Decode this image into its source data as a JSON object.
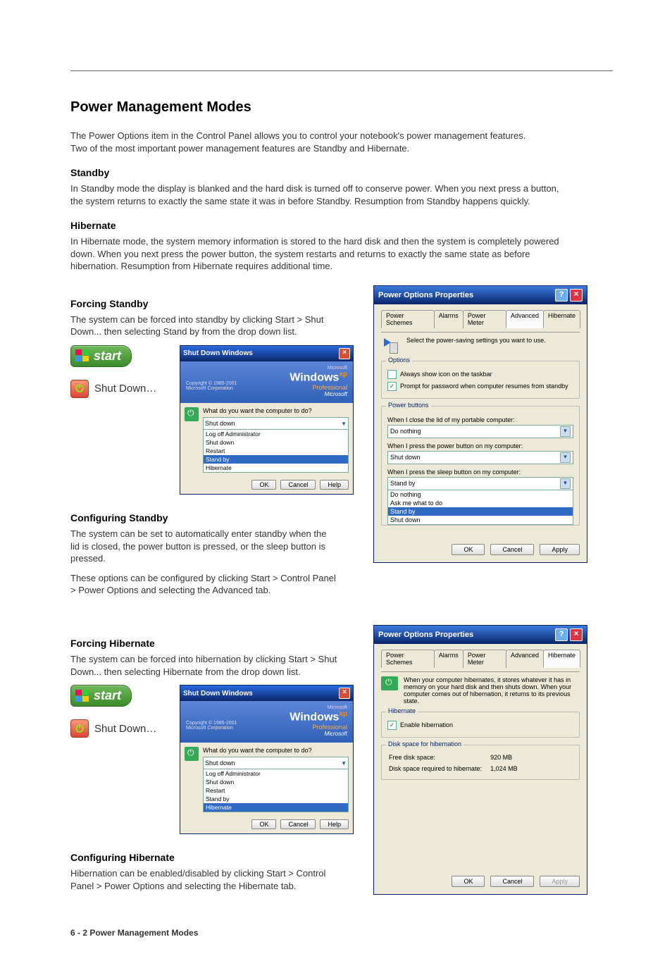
{
  "page": {
    "title": "Power Management Modes",
    "intro": "The Power Options item in the Control Panel allows you to control your notebook's power management features. Two of the most important power management features are Standby and Hibernate.",
    "standby_title": "Standby",
    "standby_body": "In Standby mode the display is blanked and the hard disk is turned off to conserve power. When you next press a button, the system returns to exactly the same state it was in before Standby. Resumption from Standby happens quickly.",
    "hibernate_title": "Hibernate",
    "hibernate_body": "In Hibernate mode, the system memory information is stored to the hard disk and then the system is completely powered down. When you next press the power button, the system restarts and returns to exactly the same state as before hibernation. Resumption from Hibernate requires additional time.",
    "standby_force_title": "Forcing Standby",
    "standby_force_body": "The system can be forced into standby by clicking Start > Shut Down... then selecting Stand by from the drop down list.",
    "standby_config_title": "Configuring Standby",
    "standby_config_body1": "The system can be set to automatically enter standby when the lid is closed, the power button is pressed, or the sleep button is pressed.",
    "standby_config_body2": "These options can be configured by clicking Start > Control Panel > Power Options and selecting the Advanced tab.",
    "hib_force_title": "Forcing Hibernate",
    "hib_force_body": "The system can be forced into hibernation by clicking Start > Shut Down... then selecting Hibernate from the drop down list.",
    "hib_config_title": "Configuring Hibernate",
    "hib_config_body": "Hibernation can be enabled/disabled by clicking Start > Control Panel > Power Options and selecting the Hibernate tab.",
    "pagenum": "6 - 2  Power Management Modes"
  },
  "start_label": "start",
  "shutdown_label": "Shut Down…",
  "shutdown_dialog": {
    "title": "Shut Down Windows",
    "brand1": "Microsoft",
    "brand2": "Windows",
    "brand3": "xp",
    "edition": "Professional",
    "copyright": "Copyright © 1985-2001",
    "corp": "Microsoft Corporation",
    "msft": "Microsoft",
    "question": "What do you want the computer to do?",
    "selected": "Shut down",
    "options": [
      "Log off Administrator",
      "Shut down",
      "Restart",
      "Stand by",
      "Hibernate"
    ],
    "ok": "OK",
    "cancel": "Cancel",
    "help": "Help"
  },
  "po_adv": {
    "title": "Power Options Properties",
    "tabs": [
      "Power Schemes",
      "Alarms",
      "Power Meter",
      "Advanced",
      "Hibernate"
    ],
    "desc": "Select the power-saving settings you want to use.",
    "grp_options": "Options",
    "chk1": "Always show icon on the taskbar",
    "chk2": "Prompt for password when computer resumes from standby",
    "grp_pb": "Power buttons",
    "lbl_lid": "When I close the lid of my portable computer:",
    "val_lid": "Do nothing",
    "lbl_pwr": "When I press the power button on my computer:",
    "val_pwr": "Shut down",
    "lbl_sleep": "When I press the sleep button on my computer:",
    "val_sleep": "Stand by",
    "dd_list": [
      "Do nothing",
      "Ask me what to do",
      "Stand by",
      "Shut down"
    ],
    "ok": "OK",
    "cancel": "Cancel",
    "apply": "Apply"
  },
  "po_hib": {
    "title": "Power Options Properties",
    "tabs": [
      "Power Schemes",
      "Alarms",
      "Power Meter",
      "Advanced",
      "Hibernate"
    ],
    "desc": "When your computer hibernates, it stores whatever it has in memory on your hard disk and then shuts down. When your computer comes out of hibernation, it returns to its previous state.",
    "grp_hib": "Hibernate",
    "chk": "Enable hibernation",
    "grp_disk": "Disk space for hibernation",
    "free_lbl": "Free disk space:",
    "free_val": "920 MB",
    "req_lbl": "Disk space required to hibernate:",
    "req_val": "1,024 MB",
    "ok": "OK",
    "cancel": "Cancel",
    "apply": "Apply"
  }
}
